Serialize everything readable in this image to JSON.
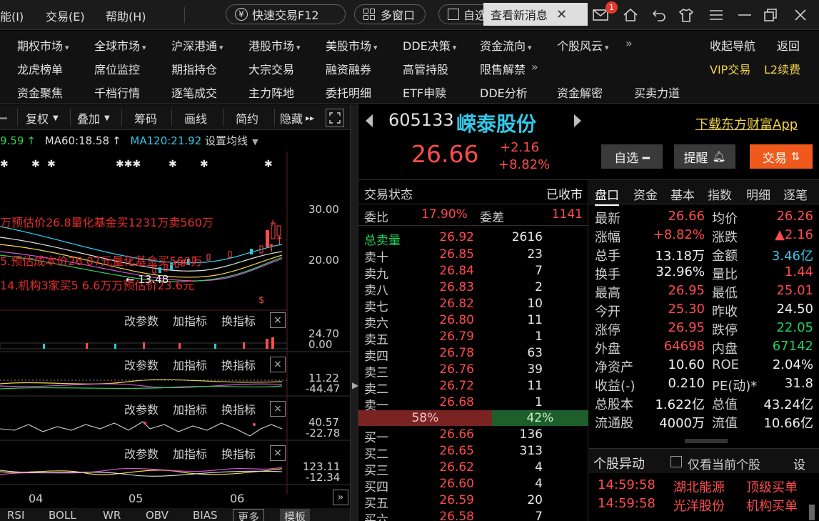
{
  "menubar": {
    "items": [
      "能(I)",
      "交易(E)",
      "帮助(H)"
    ],
    "quick_trade": "快速交易F12",
    "multi_window": "多窗口",
    "self_select_partial": "自选",
    "notify_text": "查看新消息",
    "badge_count": "1"
  },
  "nav": {
    "row1": [
      {
        "label": "期权市场",
        "caret": true
      },
      {
        "label": "全球市场",
        "caret": true
      },
      {
        "label": "沪深港通",
        "caret": true
      },
      {
        "label": "港股市场",
        "caret": true
      },
      {
        "label": "美股市场",
        "caret": true
      },
      {
        "label": "DDE决策",
        "caret": true
      },
      {
        "label": "资金流向",
        "caret": true
      },
      {
        "label": "个股风云",
        "caret": true
      }
    ],
    "row1_more": "»",
    "row1_right": [
      "收起导航",
      "返回"
    ],
    "row2": [
      "龙虎榜单",
      "席位监控",
      "期指持仓",
      "大宗交易",
      "融资融券",
      "高管持股",
      "限售解禁"
    ],
    "row2_more": "»",
    "row2_right": [
      "VIP交易",
      "L2续费"
    ],
    "row3": [
      "资金聚焦",
      "千档行情",
      "逐笔成交",
      "主力阵地",
      "委托明细",
      "ETF申赎",
      "DDE分析",
      "资金解密",
      "买卖力道"
    ]
  },
  "chart_tools": {
    "buttons": [
      "复权",
      "叠加",
      "筹码",
      "画线",
      "简约",
      "隐藏"
    ],
    "ma_labels": [
      "9.59",
      "MA60:18.58",
      "MA120:21.92"
    ],
    "ma_setting": "设置均线"
  },
  "chart": {
    "price_ticks": [
      "30.00",
      "20.00"
    ],
    "annotations": [
      "万预估价26.8量化基金买1231万卖560万",
      "5.预估成本价26.07元量化基金买560万",
      "14.机构3家买5 6.6万万预估价23.6元"
    ],
    "low_marker": "13.48",
    "sub_controls": [
      "改参数",
      "加指标",
      "换指标"
    ],
    "close_glyph": "×",
    "panel_ticks": [
      [
        "24.70",
        "0.00"
      ],
      [
        "11.22",
        "-44.47"
      ],
      [
        "40.57",
        "-22.78"
      ],
      [
        "123.11",
        "-12.34"
      ]
    ],
    "dates": [
      "04",
      "05",
      "06"
    ],
    "bottom_tabs": [
      "RSI",
      "BOLL",
      "WR",
      "OBV",
      "BIAS",
      "更多",
      "模板"
    ]
  },
  "quote": {
    "code": "605133",
    "name": "嵘泰股份",
    "price": "26.66",
    "change": "+2.16",
    "change_pct": "+8.82%",
    "download": "下载东方财富App",
    "btn_watch": "自选 ━",
    "btn_alert": "提醒",
    "btn_trade": "交易"
  },
  "book": {
    "status_label": "交易状态",
    "status_value": "已收市",
    "ratio_label": "委比",
    "ratio_value": "17.90%",
    "diff_label": "委差",
    "diff_value": "1141",
    "total_sell_label": "总卖量",
    "total_sell_price": "26.92",
    "total_sell_vol": "2616",
    "asks": [
      {
        "label": "卖十",
        "price": "26.85",
        "vol": "23"
      },
      {
        "label": "卖九",
        "price": "26.84",
        "vol": "7"
      },
      {
        "label": "卖八",
        "price": "26.83",
        "vol": "2"
      },
      {
        "label": "卖七",
        "price": "26.82",
        "vol": "10"
      },
      {
        "label": "卖六",
        "price": "26.80",
        "vol": "11"
      },
      {
        "label": "卖五",
        "price": "26.79",
        "vol": "1"
      },
      {
        "label": "卖四",
        "price": "26.78",
        "vol": "63"
      },
      {
        "label": "卖三",
        "price": "26.76",
        "vol": "39"
      },
      {
        "label": "卖二",
        "price": "26.72",
        "vol": "11"
      },
      {
        "label": "卖一",
        "price": "26.68",
        "vol": "1"
      }
    ],
    "buy_pct": "58%",
    "buy_share": 0.58,
    "sell_pct": "42%",
    "bids": [
      {
        "label": "买一",
        "price": "26.66",
        "vol": "136"
      },
      {
        "label": "买二",
        "price": "26.65",
        "vol": "313"
      },
      {
        "label": "买三",
        "price": "26.62",
        "vol": "4"
      },
      {
        "label": "买四",
        "price": "26.60",
        "vol": "4"
      },
      {
        "label": "买五",
        "price": "26.59",
        "vol": "20"
      },
      {
        "label": "买六",
        "price": "26.58",
        "vol": "7"
      }
    ]
  },
  "stats": {
    "tabs": [
      "盘口",
      "资金",
      "基本",
      "指数",
      "明细",
      "逐笔"
    ],
    "rows": [
      [
        {
          "k": "最新",
          "v": "26.66",
          "c": "red"
        },
        {
          "k": "均价",
          "v": "26.26",
          "c": "red"
        }
      ],
      [
        {
          "k": "涨幅",
          "v": "+8.82%",
          "c": "red"
        },
        {
          "k": "涨跌",
          "v": "▲2.16",
          "c": "red"
        }
      ],
      [
        {
          "k": "总手",
          "v": "13.18万",
          "c": "white"
        },
        {
          "k": "金额",
          "v": "3.46亿",
          "c": "cyan"
        }
      ],
      [
        {
          "k": "换手",
          "v": "32.96%",
          "c": "white"
        },
        {
          "k": "量比",
          "v": "1.44",
          "c": "red"
        }
      ],
      [
        {
          "k": "最高",
          "v": "26.95",
          "c": "red"
        },
        {
          "k": "最低",
          "v": "25.01",
          "c": "red"
        }
      ],
      [
        {
          "k": "今开",
          "v": "25.30",
          "c": "red"
        },
        {
          "k": "昨收",
          "v": "24.50",
          "c": "white"
        }
      ],
      [
        {
          "k": "涨停",
          "v": "26.95",
          "c": "red"
        },
        {
          "k": "跌停",
          "v": "22.05",
          "c": "green"
        }
      ],
      [
        {
          "k": "外盘",
          "v": "64698",
          "c": "red"
        },
        {
          "k": "内盘",
          "v": "67142",
          "c": "green"
        }
      ],
      [
        {
          "k": "净资产",
          "v": "10.60",
          "c": "white"
        },
        {
          "k": "ROE",
          "v": "2.04%",
          "c": "white"
        }
      ],
      [
        {
          "k": "收益(-)",
          "v": "0.210",
          "c": "white"
        },
        {
          "k": "PE(动)*",
          "v": "31.8",
          "c": "white"
        }
      ],
      [
        {
          "k": "总股本",
          "v": "1.622亿",
          "c": "white"
        },
        {
          "k": "总值",
          "v": "43.24亿",
          "c": "white"
        }
      ],
      [
        {
          "k": "流通股",
          "v": "4000万",
          "c": "white"
        },
        {
          "k": "流值",
          "v": "10.66亿",
          "c": "white"
        }
      ]
    ]
  },
  "movers": {
    "title": "个股异动",
    "checkbox_label": "仅看当前个股",
    "settings": "设",
    "rows": [
      {
        "time": "14:59:58",
        "stock": "湖北能源",
        "event": "顶级买单"
      },
      {
        "time": "14:59:58",
        "stock": "光洋股份",
        "event": "机构买单"
      }
    ]
  }
}
